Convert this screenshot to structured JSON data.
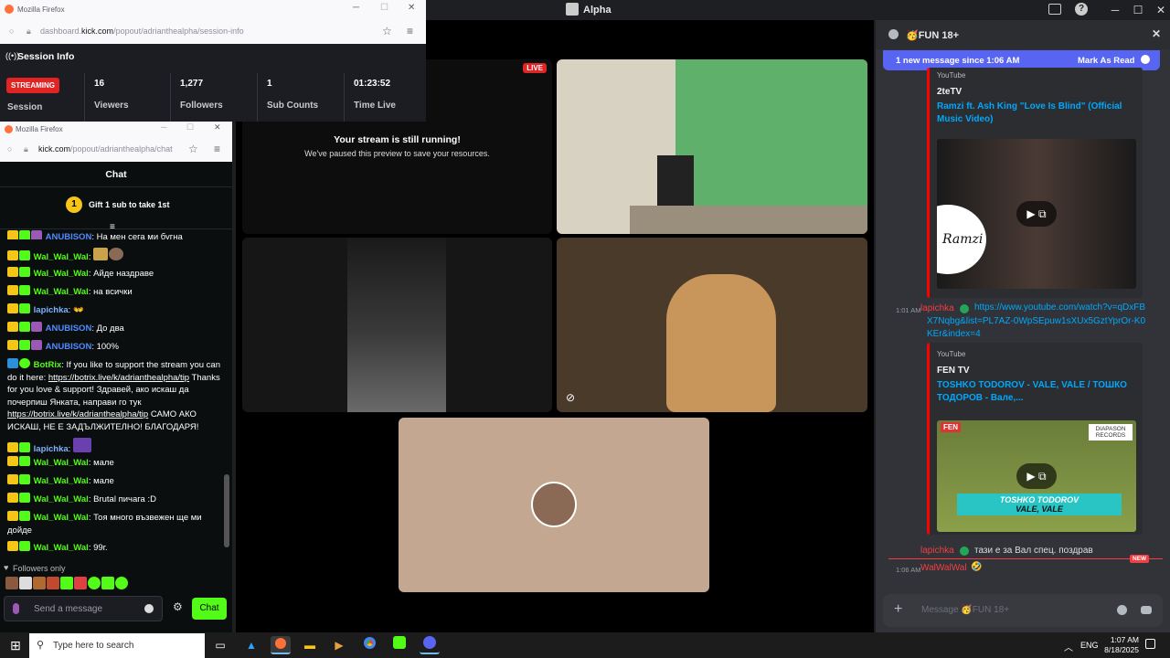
{
  "discord": {
    "window_title": "Alpha",
    "stream": {
      "live_badge": "LIVE",
      "paused_title": "Your stream is still running!",
      "paused_subtitle": "We've paused this preview to save your resources."
    },
    "channel": {
      "name": "🥳FUN 18+",
      "new_messages_banner": "1 new message since 1:06 AM",
      "mark_as_read": "Mark As Read",
      "embed1": {
        "provider": "YouTube",
        "author": "2teTV",
        "title": "Ramzi ft. Ash King \"Love Is Blind\" (Official Music Video)",
        "thumb_text": "Ramzi"
      },
      "msg1": {
        "time": "1:01 AM",
        "author": "lapichka",
        "link": "https://www.youtube.com/watch?v=qDxFBX7Nqbg&list=PL7AZ-0WpSEpuw1sXUx5GztYprOr-K0KEr&index=4"
      },
      "embed2": {
        "provider": "YouTube",
        "author": "FEN TV",
        "title": "TOSHKO TODOROV - VALE, VALE / ТОШКО ТОДОРОВ - Вале,...",
        "thumb_caption1": "TOSHKO TODOROV",
        "thumb_caption2": "VALE, VALE",
        "thumb_label": "DIAPASON RECORDS",
        "thumb_channel": "FEN"
      },
      "msg2": {
        "author": "lapichka",
        "text": "тази е за Вал спец. поздрав"
      },
      "new_divider": "NEW",
      "msg3": {
        "time": "1:06 AM",
        "author": "WalWalWal",
        "text": "🤣"
      },
      "input_placeholder": "Message 🥳FUN 18+"
    }
  },
  "session_window": {
    "app": "Mozilla Firefox",
    "url_pre": "dashboard.",
    "url_host": "kick.com",
    "url_post": "/popout/adrianthealpha/session-info",
    "header": "Session Info",
    "status": "STREAMING",
    "status_label": "Session",
    "stats": [
      {
        "value": "16",
        "label": "Viewers"
      },
      {
        "value": "1,277",
        "label": "Followers"
      },
      {
        "value": "1",
        "label": "Sub Counts"
      },
      {
        "value": "01:23:52",
        "label": "Time Live"
      }
    ]
  },
  "chat_window": {
    "app": "Mozilla Firefox",
    "url_host": "kick.com",
    "url_post": "/popout/adrianthealpha/chat",
    "header": "Chat",
    "gift_rank": "1",
    "gift_text": "Gift 1 sub to take 1st",
    "messages": [
      {
        "user": "ANUBISON",
        "color": "#4f8cff",
        "text": "На мен сега ми бугна"
      },
      {
        "user": "Wal_Wal_Wal",
        "color": "#53fc18",
        "text": ""
      },
      {
        "user": "Wal_Wal_Wal",
        "color": "#53fc18",
        "text": "Айде наздраве"
      },
      {
        "user": "Wal_Wal_Wal",
        "color": "#53fc18",
        "text": "на всички"
      },
      {
        "user": "lapichka",
        "color": "#7fb2ff",
        "text": "👐"
      },
      {
        "user": "ANUBISON",
        "color": "#4f8cff",
        "text": "До два"
      },
      {
        "user": "ANUBISON",
        "color": "#4f8cff",
        "text": "100%"
      },
      {
        "user": "BotRix",
        "color": "#53fc18",
        "text_a": "If you like to support the stream you can do it here: ",
        "link_a": "https://botrix.live/k/adrianthealpha/tip",
        "text_b": " Thanks for you love & support! Здравей, ако искаш да почерпиш Янката, направи го тук ",
        "link_b": "https://botrix.live/k/adrianthealpha/tip",
        "text_c": " САМО АКО ИСКАШ, НЕ Е ЗАДЪЛЖИТЕЛНО! БЛАГОДАРЯ!"
      },
      {
        "user": "lapichka",
        "color": "#7fb2ff",
        "text": ""
      },
      {
        "user": "Wal_Wal_Wal",
        "color": "#53fc18",
        "text": "мале"
      },
      {
        "user": "Wal_Wal_Wal",
        "color": "#53fc18",
        "text": "мале"
      },
      {
        "user": "Wal_Wal_Wal",
        "color": "#53fc18",
        "text": "Brutal пичага :D"
      },
      {
        "user": "Wal_Wal_Wal",
        "color": "#53fc18",
        "text": "Тоя много възвежен ще ми дойде"
      },
      {
        "user": "Wal_Wal_Wal",
        "color": "#53fc18",
        "text": "99г."
      }
    ],
    "followers_only": "Followers only",
    "input_placeholder": "Send a message",
    "send_button": "Chat"
  },
  "taskbar": {
    "search_placeholder": "Type here to search",
    "lang": "ENG",
    "time": "1:07 AM",
    "date": "8/18/2025"
  },
  "colors": {
    "kick_green": "#53fc18",
    "discord_blurple": "#5865f2",
    "youtube_red": "#ff0000",
    "live_red": "#e02424"
  }
}
